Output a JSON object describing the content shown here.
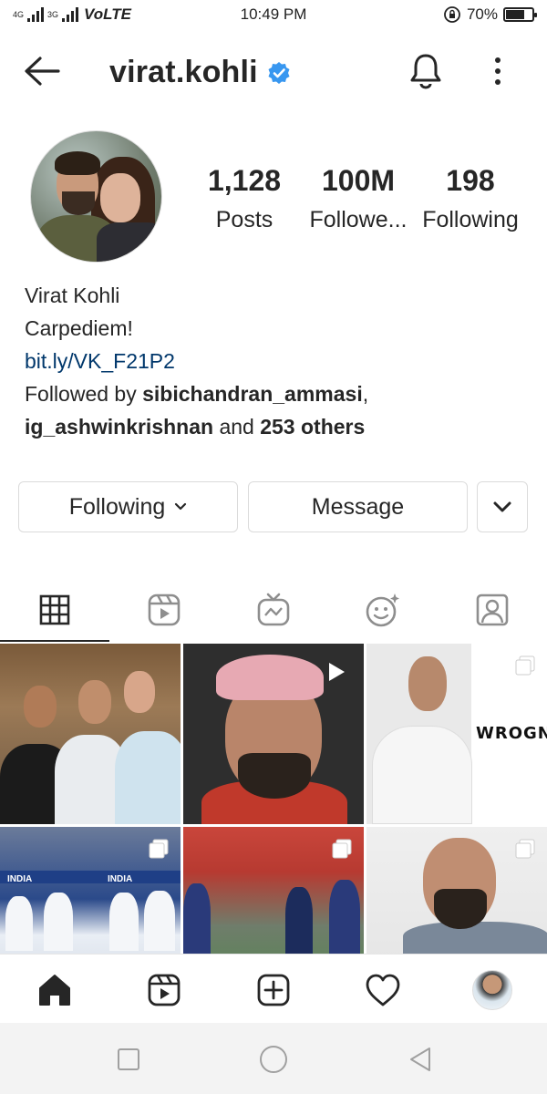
{
  "status_bar": {
    "network_small_1": "4G",
    "network_small_2": "3G",
    "volte": "VoLTE",
    "time": "10:49 PM",
    "battery": "70%"
  },
  "header": {
    "username": "virat.kohli",
    "verified_icon": "verified-badge-icon",
    "accent_color": "#3897f0"
  },
  "profile": {
    "stats": [
      {
        "value": "1,128",
        "label": "Posts"
      },
      {
        "value": "100M",
        "label": "Followe..."
      },
      {
        "value": "198",
        "label": "Following"
      }
    ],
    "name": "Virat Kohli",
    "bio": "Carpediem!",
    "link": "bit.ly/VK_F21P2",
    "followed_by_prefix": "Followed by ",
    "followed_by_user1": "sibichandran_ammasi",
    "followed_by_sep": ",",
    "followed_by_user2": "ig_ashwinkrishnan",
    "followed_by_and": " and ",
    "followed_by_others": "253 others"
  },
  "actions": {
    "following_label": "Following",
    "message_label": "Message"
  },
  "tabs": [
    {
      "icon": "grid-icon",
      "active": true
    },
    {
      "icon": "reels-icon",
      "active": false
    },
    {
      "icon": "igtv-icon",
      "active": false
    },
    {
      "icon": "effects-icon",
      "active": false
    },
    {
      "icon": "tagged-icon",
      "active": false
    }
  ],
  "grid": {
    "post3_text": "WROGN",
    "post4_text_a": "INDIA",
    "post4_text_b": "INDIA"
  },
  "bottom_nav": [
    "home-icon",
    "reels-icon",
    "new-post-icon",
    "activity-heart-icon",
    "profile-avatar"
  ]
}
